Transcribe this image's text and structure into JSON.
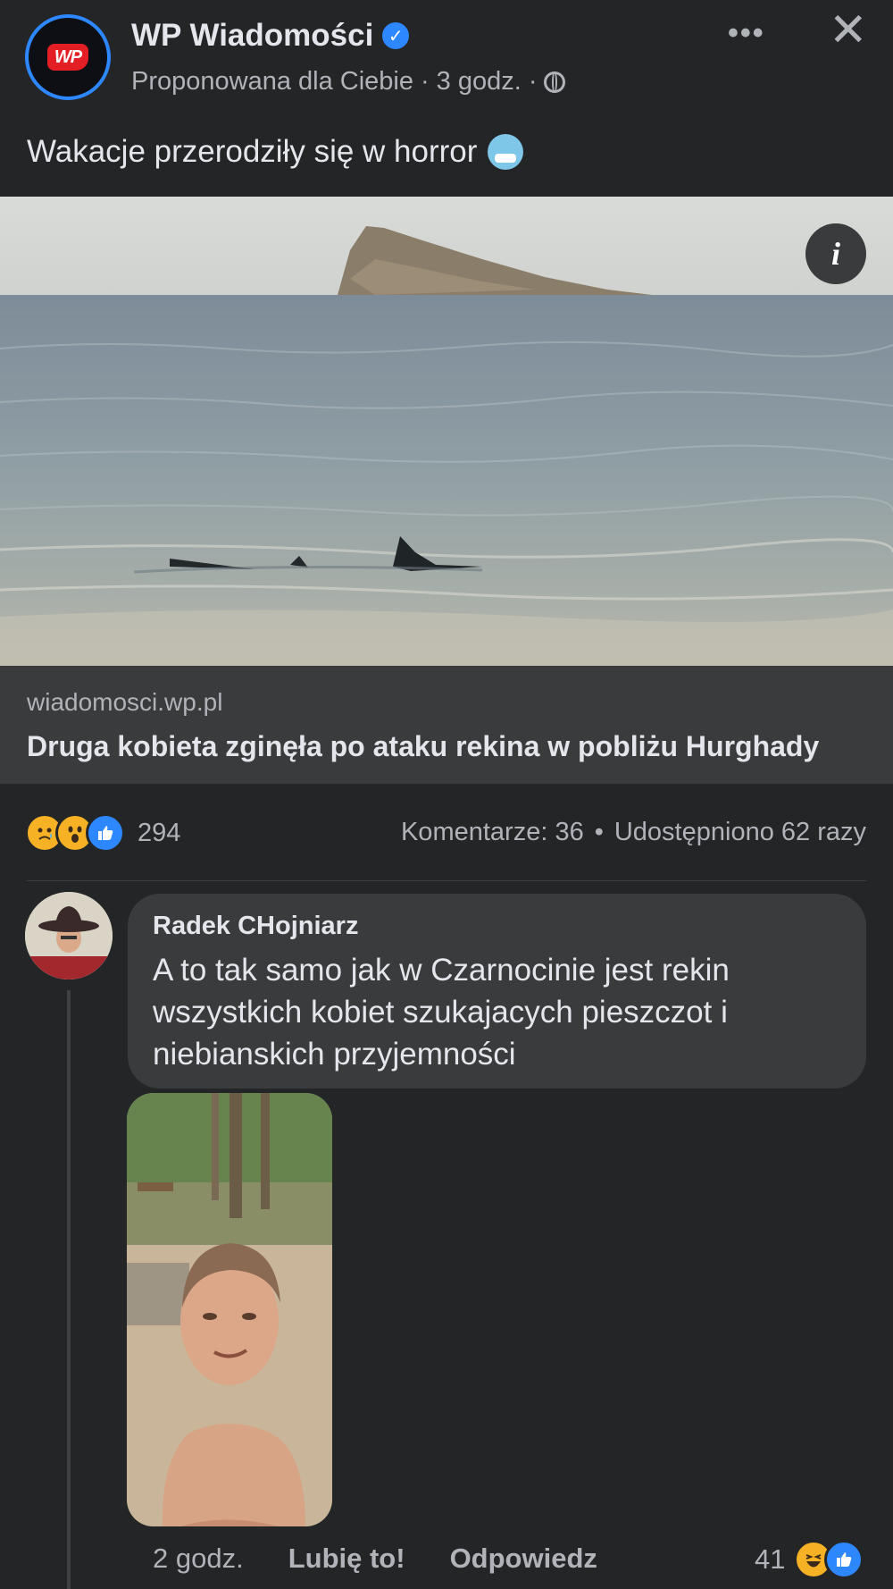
{
  "post": {
    "page_name": "WP Wiadomości",
    "page_logo_text": "WP",
    "suggested_label": "Proponowana dla Ciebie",
    "time": "3 godz.",
    "separator": "·",
    "text": "Wakacje przerodziły się w horror",
    "emoji": "cold-face-emoji"
  },
  "link": {
    "domain": "wiadomosci.wp.pl",
    "title": "Druga kobieta zginęła po ataku rekina w pobliżu Hurghady"
  },
  "reactions": {
    "types": [
      "sad",
      "wow",
      "like"
    ],
    "count": "294",
    "comments": "Komentarze: 36",
    "bullet": "•",
    "shares": "Udostępniono 62 razy"
  },
  "comment": {
    "author": "Radek CHojniarz",
    "text": "A to tak samo jak w Czarnocinie jest rekin wszystkich kobiet szukajacych pieszczot i niebianskich przyjemności",
    "time": "2 godz.",
    "like_label": "Lubię to!",
    "reply_label": "Odpowiedz",
    "reaction_count": "41",
    "reaction_types": [
      "haha",
      "like"
    ]
  },
  "icons": {
    "more": "more-icon",
    "close": "close-icon",
    "verified": "verified-icon",
    "globe": "globe-icon",
    "info": "info-icon"
  },
  "colors": {
    "background": "#242527",
    "card": "#3a3b3c",
    "accent": "#2d88ff",
    "text": "#e4e6eb",
    "muted": "#b0b3b8"
  }
}
